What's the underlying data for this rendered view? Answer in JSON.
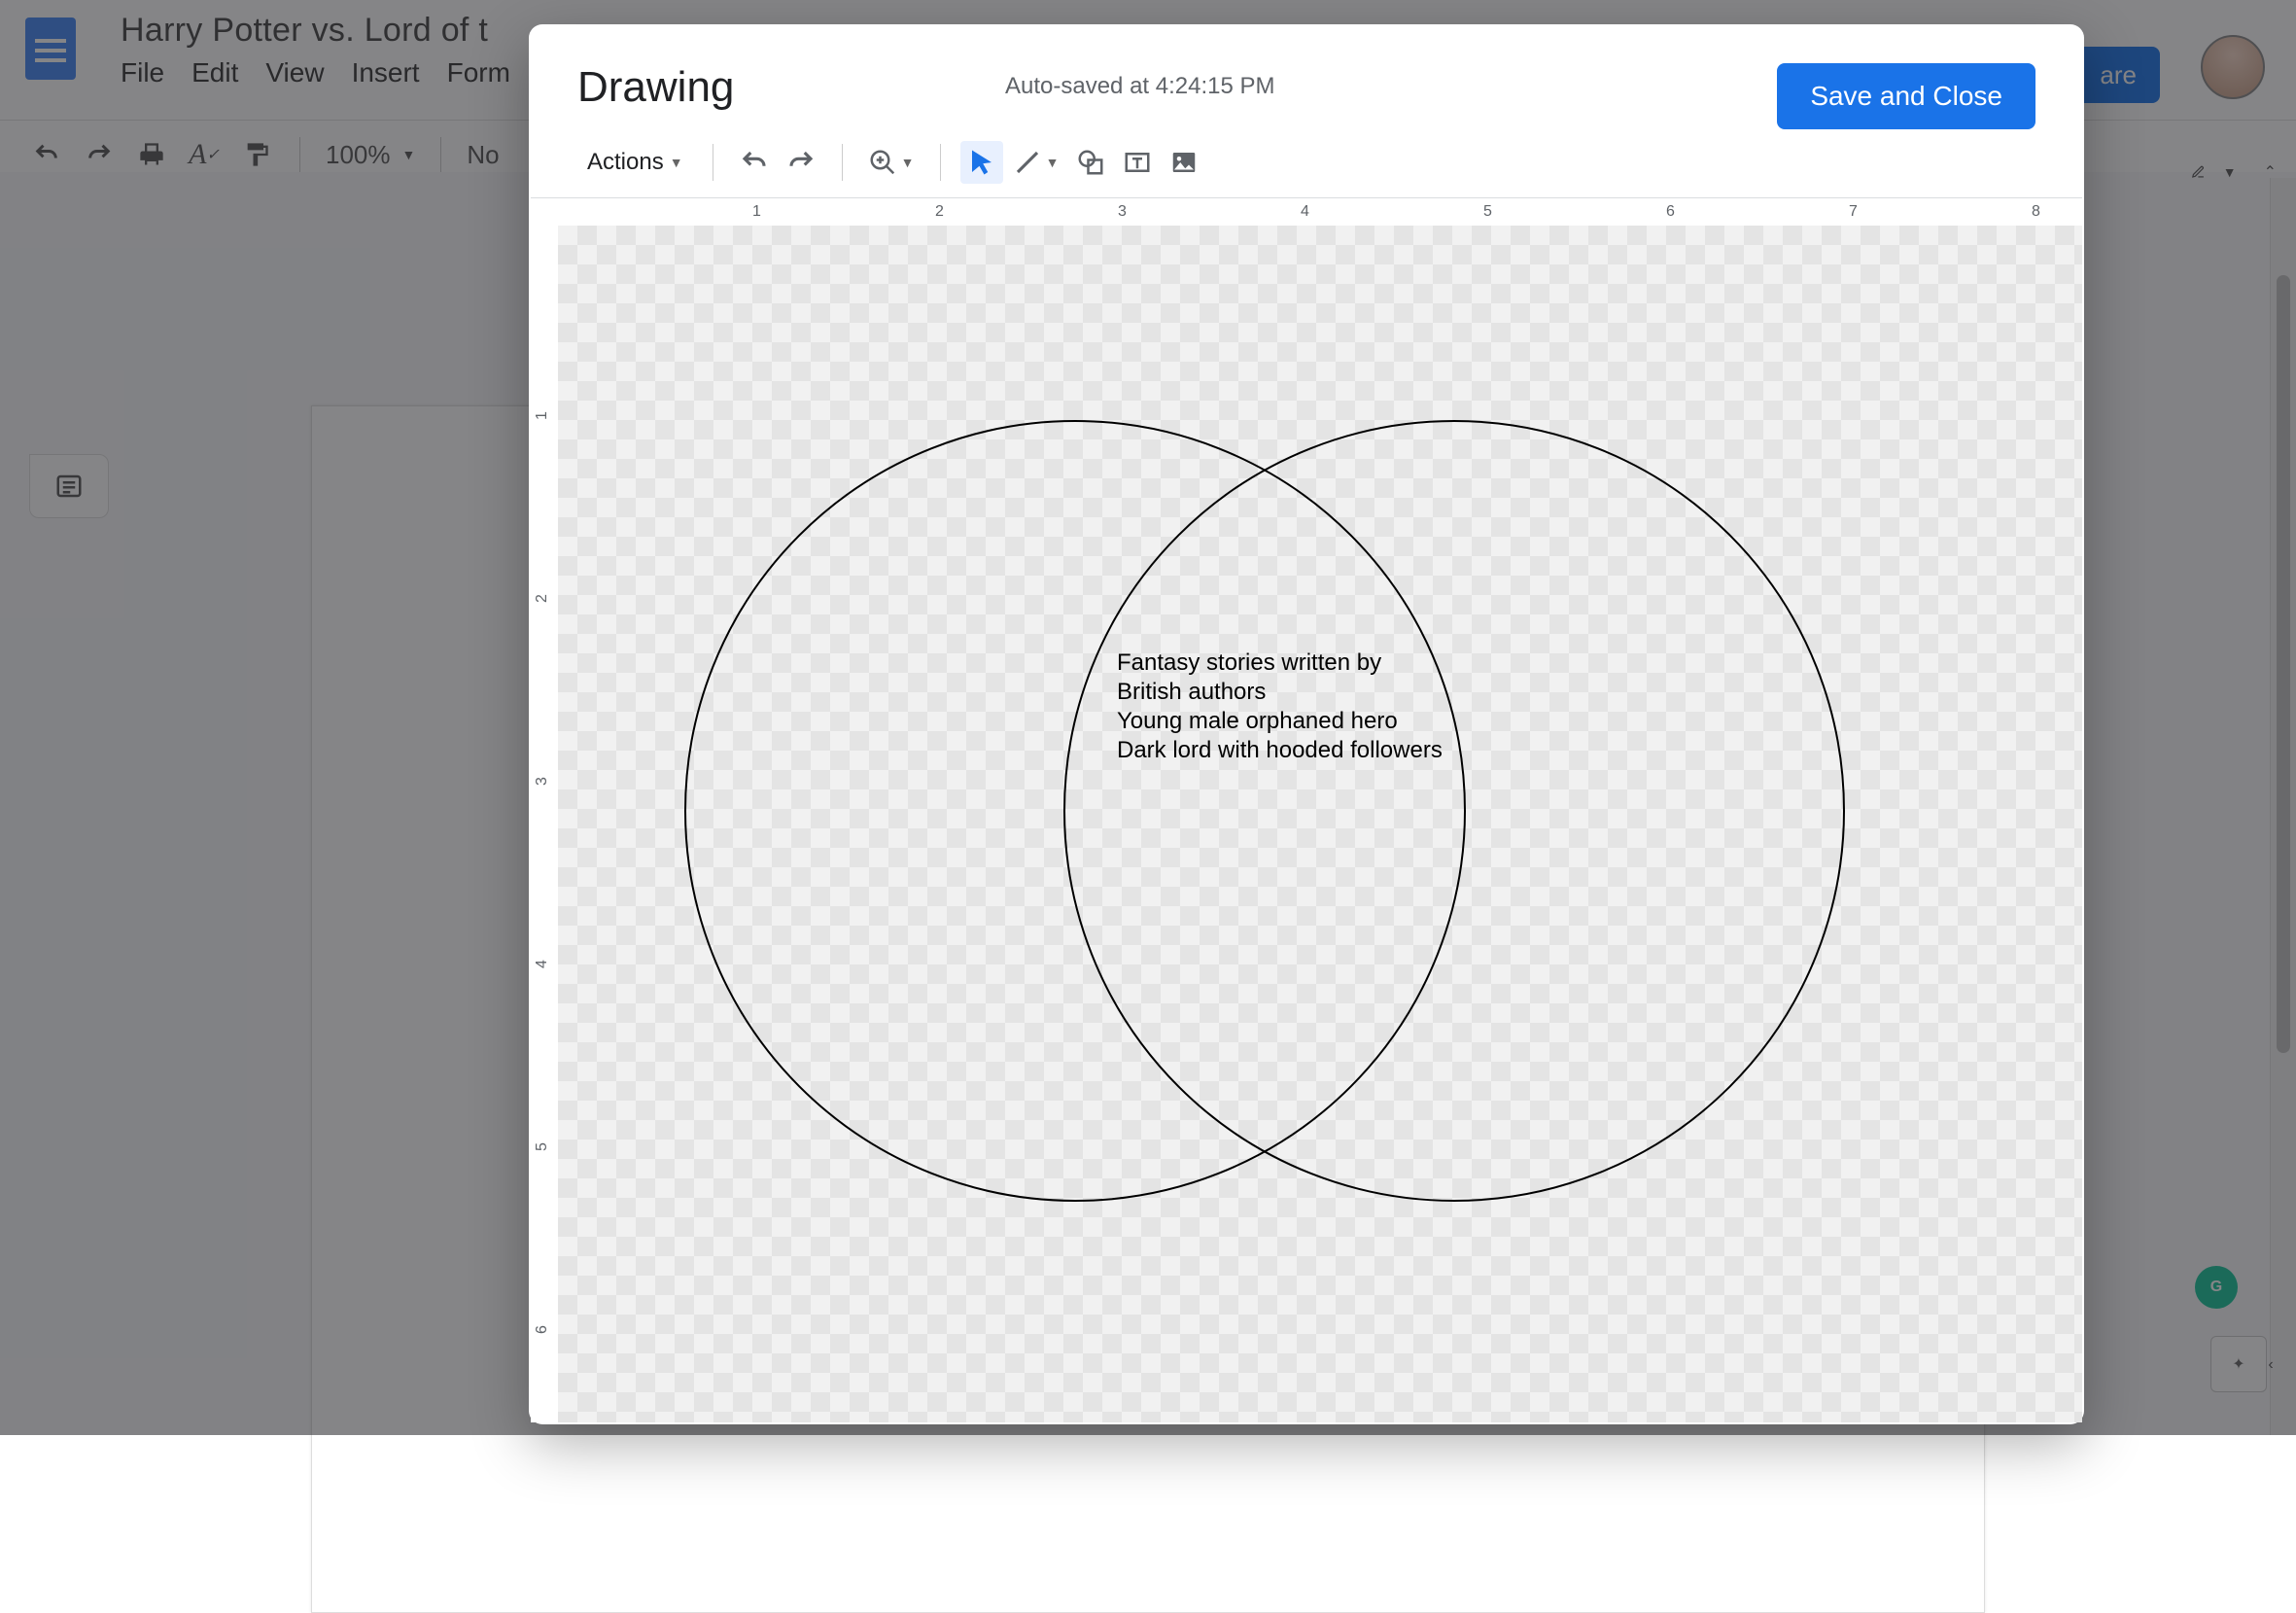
{
  "doc": {
    "title": "Harry Potter vs. Lord of t",
    "menus": [
      "File",
      "Edit",
      "View",
      "Insert",
      "Form"
    ],
    "share_label": "are",
    "zoom": "100%",
    "styles_partial": "No"
  },
  "dialog": {
    "title": "Drawing",
    "status": "Auto-saved at 4:24:15 PM",
    "save_button": "Save and Close",
    "actions_label": "Actions"
  },
  "ruler": {
    "h": [
      "1",
      "2",
      "3",
      "4",
      "5",
      "6",
      "7",
      "8"
    ],
    "v": [
      "1",
      "2",
      "3",
      "4",
      "5",
      "6"
    ]
  },
  "venn": {
    "lines": [
      "Fantasy stories written by",
      "British authors",
      "Young male orphaned hero",
      "Dark lord with hooded followers"
    ]
  },
  "chart_data": {
    "type": "diagram",
    "subtype": "venn-2",
    "left_set": [],
    "right_set": [],
    "intersection": [
      "Fantasy stories written by British authors",
      "Young male orphaned hero",
      "Dark lord with hooded followers"
    ]
  }
}
